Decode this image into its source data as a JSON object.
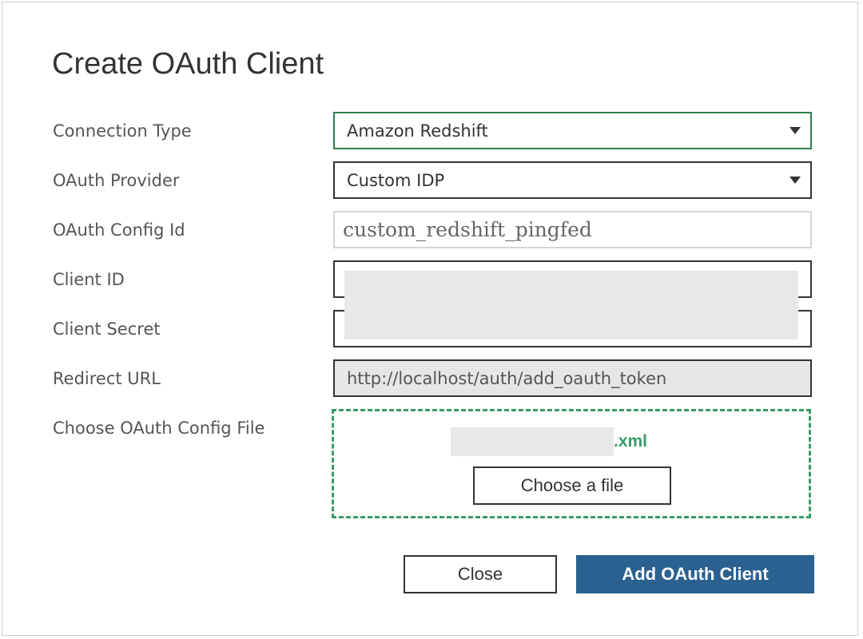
{
  "dialog": {
    "title": "Create OAuth Client"
  },
  "form": {
    "connection_type": {
      "label": "Connection Type",
      "value": "Amazon Redshift"
    },
    "oauth_provider": {
      "label": "OAuth Provider",
      "value": "Custom IDP"
    },
    "oauth_config_id": {
      "label": "OAuth Config Id",
      "value": "custom_redshift_pingfed"
    },
    "client_id": {
      "label": "Client ID"
    },
    "client_secret": {
      "label": "Client Secret"
    },
    "redirect_url": {
      "label": "Redirect URL",
      "value": "http://localhost/auth/add_oauth_token"
    },
    "config_file": {
      "label": "Choose OAuth Config File",
      "file_extension": ".xml",
      "choose_button": "Choose a file"
    }
  },
  "actions": {
    "close": "Close",
    "add": "Add OAuth Client"
  },
  "colors": {
    "primary_button": "#2a6190",
    "focus_border": "#2e7d4f",
    "dropzone_accent": "#3a9a6a"
  }
}
